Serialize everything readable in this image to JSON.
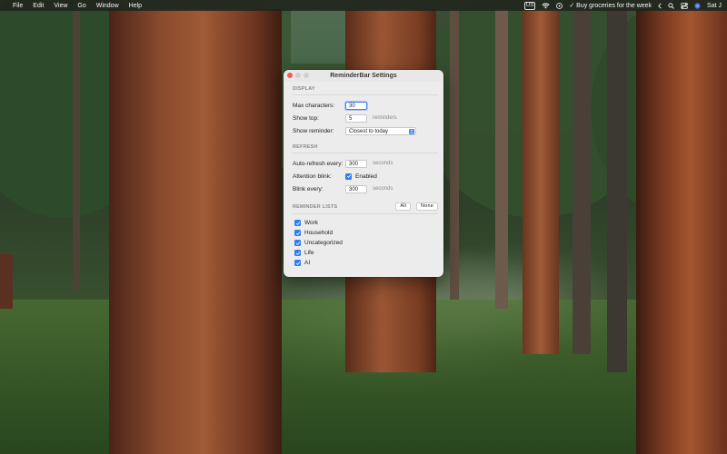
{
  "menubar": {
    "items": [
      "File",
      "Edit",
      "View",
      "Go",
      "Window",
      "Help"
    ],
    "input_source": "US",
    "reminder_status": "✓ Buy groceries for the week",
    "clock": "Sat J"
  },
  "window": {
    "title": "ReminderBar Settings",
    "display": {
      "header": "DISPLAY",
      "max_chars_label": "Max characters:",
      "max_chars_value": "30",
      "show_top_label": "Show top:",
      "show_top_value": "5",
      "show_top_unit": "reminders",
      "show_reminder_label": "Show reminder:",
      "show_reminder_value": "Closest to today"
    },
    "refresh": {
      "header": "REFRESH",
      "auto_refresh_label": "Auto-refresh every:",
      "auto_refresh_value": "300",
      "auto_refresh_unit": "seconds",
      "attention_blink_label": "Attention blink:",
      "attention_blink_checkbox": "Enabled",
      "blink_every_label": "Blink every:",
      "blink_every_value": "300",
      "blink_every_unit": "seconds"
    },
    "reminder_lists": {
      "header": "REMINDER LISTS",
      "all_button": "All",
      "none_button": "None",
      "items": [
        {
          "label": "Work",
          "checked": true
        },
        {
          "label": "Household",
          "checked": true
        },
        {
          "label": "Uncategorized",
          "checked": true
        },
        {
          "label": "Life",
          "checked": true
        },
        {
          "label": "AI",
          "checked": true
        }
      ]
    }
  },
  "colors": {
    "accent": "#2f7cf6",
    "close": "#ec5f57"
  }
}
